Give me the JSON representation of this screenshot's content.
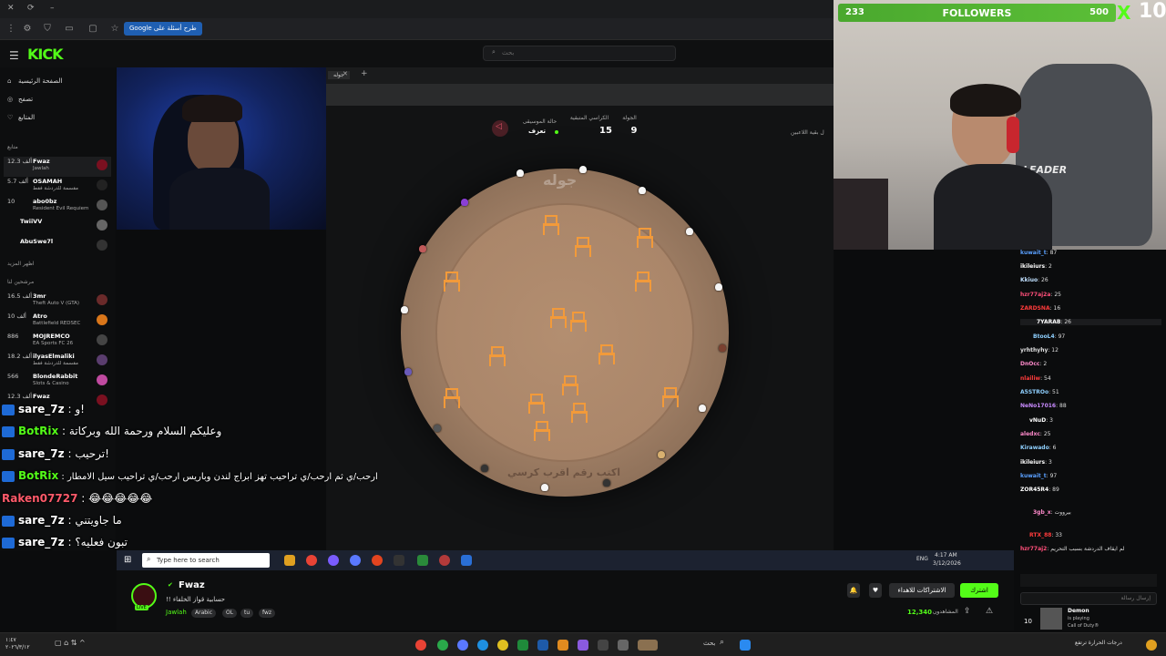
{
  "browser": {
    "google_pill": "Google طرح أسئلة على"
  },
  "kick": {
    "logo": "KICK",
    "search_placeholder": "بحث"
  },
  "sidebar": {
    "nav": [
      {
        "label": "الصفحة الرئيسية",
        "icon": "home-icon"
      },
      {
        "label": "تصفح",
        "icon": "compass-icon"
      },
      {
        "label": "المتابع",
        "icon": "heart-icon"
      }
    ],
    "following_header": "متابع",
    "recommended_header": "مرشحين لنا",
    "show_more": "اظهر المزيد",
    "channels": [
      {
        "viewers": "12.3 ألف",
        "name": "Fwaz",
        "game": "Jawlah"
      },
      {
        "viewers": "5.7 ألف",
        "name": "OSAMAH",
        "game": "مقسمة للدردشة فقط"
      },
      {
        "viewers": "10",
        "name": "abo0bz",
        "game": "Resident Evil Requiem"
      },
      {
        "viewers": "",
        "name": "TwiiVV",
        "game": ""
      },
      {
        "viewers": "",
        "name": "AbuSwe7l",
        "game": ""
      }
    ],
    "recommended": [
      {
        "viewers": "16.5 ألف",
        "name": "3mr",
        "game": "Theft Auto V (GTA)"
      },
      {
        "viewers": "10 ألف",
        "name": "Atro",
        "game": "Battlefield REDSEC"
      },
      {
        "viewers": "886",
        "name": "MOJREMCO",
        "game": "EA Sports FC 26"
      },
      {
        "viewers": "18.2 ألف",
        "name": "ilyasElmaliki",
        "game": "مقسمة للدردشة فقط"
      },
      {
        "viewers": "566",
        "name": "BlondeRabbit",
        "game": "Slots & Casino"
      },
      {
        "viewers": "12.3 ألف",
        "name": "Fwaz",
        "game": ""
      }
    ]
  },
  "tabs": {
    "tab1": "جوله",
    "add": "+"
  },
  "game": {
    "music_label": "حالة الموسيقى",
    "music_value": "تعزف",
    "chairs_label": "الكراسي المتبقية",
    "chairs_value": "15",
    "round_label": "الجولة",
    "round_value": "9",
    "hint": "ل بقية اللاعبين",
    "table_word": "جوله",
    "prompt": "اكتب رقم اقرب كرسي"
  },
  "overlay_chat": [
    {
      "user": "sare_7z",
      "sep": " : ",
      "text": "و! "
    },
    {
      "user": "BotRix",
      "sep": " : ",
      "text": "وعليكم السلام ورحمة الله وبركاتة"
    },
    {
      "user": "sare_7z",
      "sep": " : ",
      "text": "ترحيب!"
    },
    {
      "user": "BotRix",
      "sep": " : ",
      "text": "ارحب/ي ثم ارحب/ي تراحيب تهز ابراج لندن وباريس ارحب/ي تراحيب سيل الامطار"
    },
    {
      "user": "Raken07727",
      "sep": " : ",
      "text": "😂😂😂😂😂"
    },
    {
      "user": "sare_7z",
      "sep": " : ",
      "text": "ما جاويتني"
    },
    {
      "user": "sare_7z",
      "sep": " : ",
      "text": "تبون فعليه؟"
    }
  ],
  "followers": {
    "current": "233",
    "label": "FOLLOWERS",
    "goal": "500",
    "x": "X",
    "count": "10"
  },
  "right_chat": [
    {
      "user": "kuwait_t",
      "text": ": 87"
    },
    {
      "user": "ikileiurs",
      "text": ": 2"
    },
    {
      "user": "Kkiuo",
      "text": ": 26"
    },
    {
      "user": "hzr77aj2a",
      "text": ": 25"
    },
    {
      "user": "ZARDSNA",
      "text": ": 16"
    },
    {
      "user": "7YARAB",
      "text": ": 26"
    },
    {
      "user": "BtooL4",
      "text": ": 97"
    },
    {
      "user": "yrhthyhy",
      "text": ": 12"
    },
    {
      "user": "DnOcc",
      "text": ": 2"
    },
    {
      "user": "nlailiw",
      "text": ": 54"
    },
    {
      "user": "A5STROo",
      "text": ": 51"
    },
    {
      "user": "NeNo17016",
      "text": ": 88"
    },
    {
      "user": "vNuD",
      "text": ": 3"
    },
    {
      "user": "aledxc",
      "text": ": 25"
    },
    {
      "user": "Kirawado",
      "text": ": 6"
    },
    {
      "user": "ikileiurs",
      "text": ": 3"
    },
    {
      "user": "kuwait_t",
      "text": ": 97"
    },
    {
      "user": "ZOR45R4",
      "text": ": 89"
    },
    {
      "user": "3gb_x",
      "text": ": بيرووت"
    },
    {
      "user": "RTX_88",
      "text": ": 33"
    },
    {
      "user": "hzr77aj2",
      "text": ": لم ايقاف الدردشة بسبب التحريم"
    }
  ],
  "windows_taskbar": {
    "search": "Type here to search",
    "lang": "ENG",
    "time": "4:17 AM",
    "date": "3/12/2026"
  },
  "stream_info": {
    "name": "Fwaz",
    "title": "!! حسابية قواز الخلفاء",
    "category": "Jawlah",
    "tags": [
      "Arabic",
      "OL",
      "tu",
      "fwz"
    ],
    "live": "LIVE",
    "follow_btn": "اشترك",
    "subscribe_btn": "الاشتراكات للاهداء",
    "viewers": "12,340",
    "viewers_label": "المشاهدون"
  },
  "right_panel": {
    "demon_name": "Demon",
    "demon_status": "is playing",
    "demon_game": "Call of Duty®",
    "count": "10",
    "send_placeholder": "إرسال رسالة"
  },
  "bottom_taskbar": {
    "left_time": "١:٤٧",
    "left_date": "٢٠٢٦/٣/١٢",
    "right_text": "درجات الحرارة ترتفع",
    "search": "بحث"
  }
}
